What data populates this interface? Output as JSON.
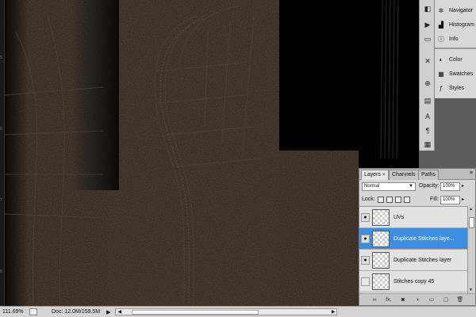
{
  "status_bar": {
    "zoom": "111.69%",
    "doc_info": "Doc: 12.0M/159.5M"
  },
  "ruler": {
    "ticks": [
      "5",
      "6",
      "7",
      "8"
    ]
  },
  "side_panels": {
    "navigator": "Navigator",
    "histogram": "Histogram",
    "info": "Info",
    "color": "Color",
    "swatches": "Swatches",
    "styles": "Styles"
  },
  "layers_panel": {
    "tabs": [
      "Layers",
      "Channels",
      "Paths"
    ],
    "tab_close": "×",
    "menu_icon": "≡",
    "blend_mode": "Normal",
    "opacity_label": "Opacity:",
    "opacity_value": "100%",
    "lock_label": "Lock:",
    "fill_label": "Fill:",
    "fill_value": "100%",
    "layers": [
      {
        "name": "UVs",
        "visible": true,
        "selected": false
      },
      {
        "name": "Duplicate Stitches laye...",
        "visible": true,
        "selected": true
      },
      {
        "name": "Duplicate Stitches layer",
        "visible": true,
        "selected": false
      },
      {
        "name": "Stitches copy 45",
        "visible": false,
        "selected": false
      }
    ],
    "footer_icons": [
      "link-icon",
      "fx-icon",
      "mask-icon",
      "adjustment-icon",
      "folder-icon",
      "new-layer-icon",
      "trash-icon"
    ],
    "footer_fx": "fx."
  },
  "colors": {
    "selection": "#3d8ee0",
    "panel_bg": "#d6d6d6",
    "leather": "#2a2019"
  }
}
